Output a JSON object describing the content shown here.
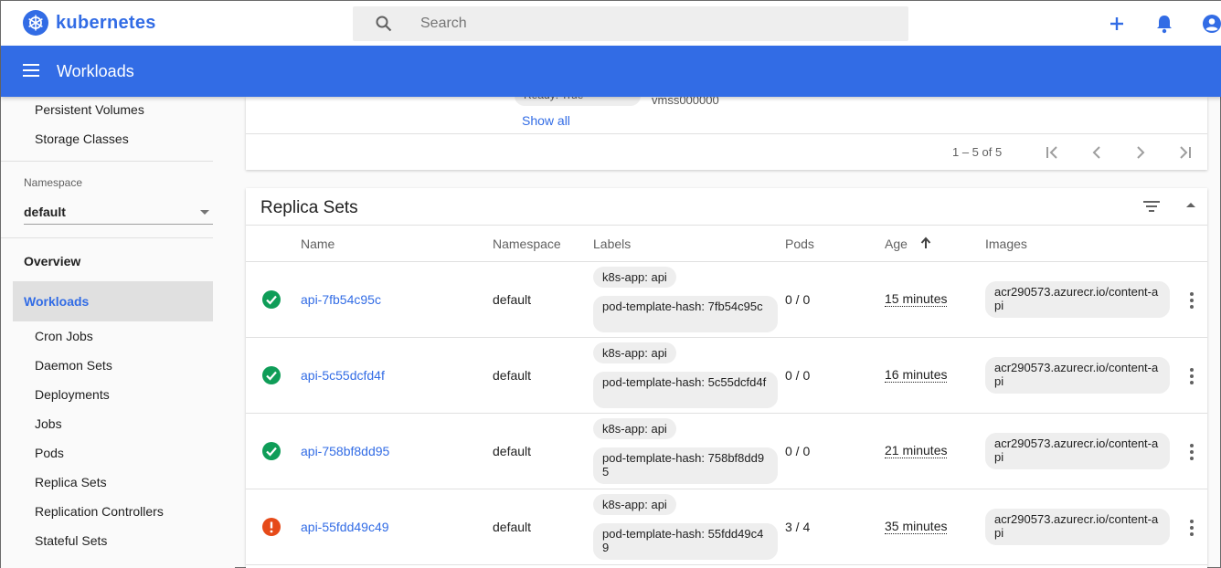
{
  "header": {
    "logo_text": "kubernetes",
    "search_placeholder": "Search",
    "brand_color": "#326ce5"
  },
  "titlebar": {
    "title": "Workloads"
  },
  "sidebar": {
    "top_items": [
      "Persistent Volumes",
      "Storage Classes"
    ],
    "namespace_label": "Namespace",
    "namespace_value": "default",
    "overview_label": "Overview",
    "workloads_label": "Workloads",
    "workload_items": [
      "Cron Jobs",
      "Daemon Sets",
      "Deployments",
      "Jobs",
      "Pods",
      "Replica Sets",
      "Replication Controllers",
      "Stateful Sets"
    ]
  },
  "prev_card": {
    "node_chip": "Ready: True",
    "node_text": "vmss000000",
    "show_all": "Show all",
    "range": "1 – 5 of 5"
  },
  "replica_sets": {
    "title": "Replica Sets",
    "columns": {
      "name": "Name",
      "namespace": "Namespace",
      "labels": "Labels",
      "pods": "Pods",
      "age": "Age",
      "images": "Images"
    },
    "rows": [
      {
        "status": "ok",
        "name": "api-7fb54c95c",
        "namespace": "default",
        "label1": "k8s-app: api",
        "label2": "pod-template-hash: 7fb54c95c",
        "pods": "0 / 0",
        "age": "15 minutes",
        "image": "acr290573.azurecr.io/content-api"
      },
      {
        "status": "ok",
        "name": "api-5c55dcfd4f",
        "namespace": "default",
        "label1": "k8s-app: api",
        "label2": "pod-template-hash: 5c55dcfd4f",
        "pods": "0 / 0",
        "age": "16 minutes",
        "image": "acr290573.azurecr.io/content-api"
      },
      {
        "status": "ok",
        "name": "api-758bf8dd95",
        "namespace": "default",
        "label1": "k8s-app: api",
        "label2": "pod-template-hash: 758bf8dd95",
        "pods": "0 / 0",
        "age": "21 minutes",
        "image": "acr290573.azurecr.io/content-api"
      },
      {
        "status": "error",
        "name": "api-55fdd49c49",
        "namespace": "default",
        "label1": "k8s-app: api",
        "label2": "pod-template-hash: 55fdd49c49",
        "pods": "3 / 4",
        "age": "35 minutes",
        "image": "acr290573.azurecr.io/content-api"
      }
    ]
  }
}
